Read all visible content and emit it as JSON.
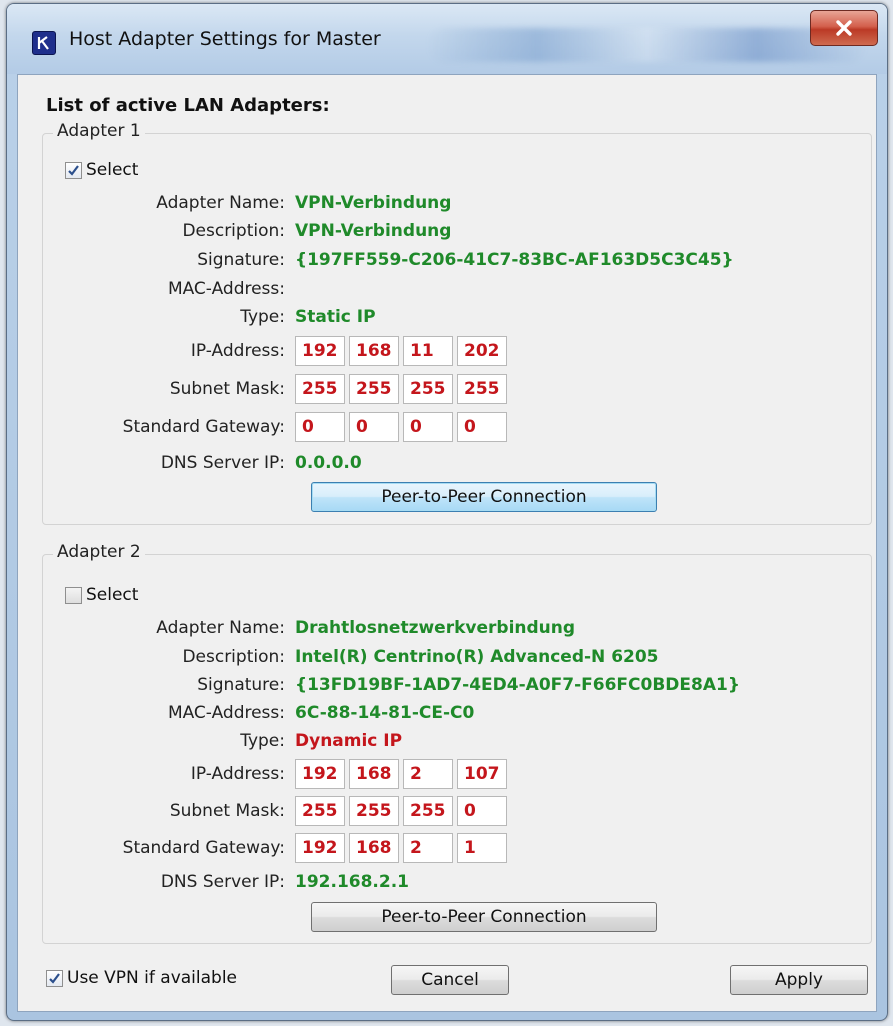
{
  "window": {
    "title": "Host Adapter Settings for Master"
  },
  "list_title": "List of active LAN Adapters:",
  "labels": {
    "select": "Select",
    "adapter_name": "Adapter Name:",
    "description": "Description:",
    "signature": "Signature:",
    "mac": "MAC-Address:",
    "type": "Type:",
    "ip": "IP-Address:",
    "subnet": "Subnet Mask:",
    "gateway": "Standard Gateway:",
    "dns": "DNS Server IP:",
    "p2p": "Peer-to-Peer Connection"
  },
  "adapters": [
    {
      "legend": "Adapter 1",
      "selected": true,
      "name": "VPN-Verbindung",
      "description": "VPN-Verbindung",
      "signature": "{197FF559-C206-41C7-83BC-AF163D5C3C45}",
      "mac": "",
      "type": "Static IP",
      "type_color": "green",
      "ip": [
        "192",
        "168",
        "11",
        "202"
      ],
      "subnet": [
        "255",
        "255",
        "255",
        "255"
      ],
      "gateway": [
        "0",
        "0",
        "0",
        "0"
      ],
      "dns": "0.0.0.0"
    },
    {
      "legend": "Adapter 2",
      "selected": false,
      "name": "Drahtlosnetzwerkverbindung",
      "description": "Intel(R) Centrino(R) Advanced-N 6205",
      "signature": "{13FD19BF-1AD7-4ED4-A0F7-F66FC0BDE8A1}",
      "mac": "6C-88-14-81-CE-C0",
      "type": "Dynamic IP",
      "type_color": "red",
      "ip": [
        "192",
        "168",
        "2",
        "107"
      ],
      "subnet": [
        "255",
        "255",
        "255",
        "0"
      ],
      "gateway": [
        "192",
        "168",
        "2",
        "1"
      ],
      "dns": "192.168.2.1"
    }
  ],
  "footer": {
    "use_vpn_label": "Use VPN if available",
    "use_vpn_checked": true,
    "cancel_label": "Cancel",
    "apply_label": "Apply"
  },
  "colors": {
    "value_green": "#1f8a2a",
    "value_red": "#c4161c"
  }
}
